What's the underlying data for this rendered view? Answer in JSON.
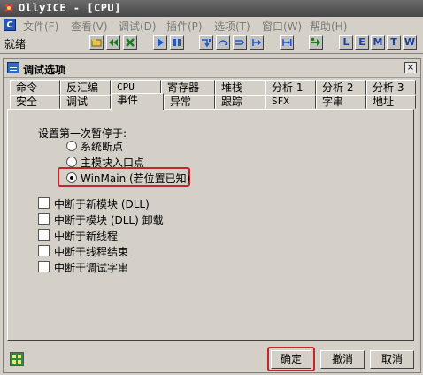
{
  "window": {
    "title": "OllyICE - [CPU]"
  },
  "menu": {
    "app_icon": "C",
    "items": [
      "文件(F)",
      "查看(V)",
      "调试(D)",
      "插件(P)",
      "选项(T)",
      "窗口(W)",
      "帮助(H)"
    ]
  },
  "toolbar": {
    "status": "就绪",
    "letters": [
      "L",
      "E",
      "M",
      "T",
      "W"
    ]
  },
  "dialog": {
    "title": "调试选项",
    "close": "×",
    "tabs_row1": [
      "命令",
      "反汇编",
      "CPU",
      "寄存器",
      "堆栈",
      "分析 1",
      "分析 2",
      "分析 3"
    ],
    "tabs_row2": [
      "安全",
      "调试",
      "事件",
      "异常",
      "跟踪",
      "SFX",
      "字串",
      "地址"
    ],
    "group_label": "设置第一次暂停于:",
    "radios": [
      "系统断点",
      "主模块入口点",
      "WinMain (若位置已知)"
    ],
    "radio_selected": "WinMain (若位置已知)",
    "checkboxes": [
      "中断于新模块 (DLL)",
      "中断于模块 (DLL) 卸载",
      "中断于新线程",
      "中断于线程结束",
      "中断于调试字串"
    ],
    "buttons": {
      "ok": "确定",
      "cancel": "撤消",
      "cancel2": "取消"
    }
  },
  "colors": {
    "highlight": "#c0272d",
    "titlebar": "#5a5a5a"
  }
}
